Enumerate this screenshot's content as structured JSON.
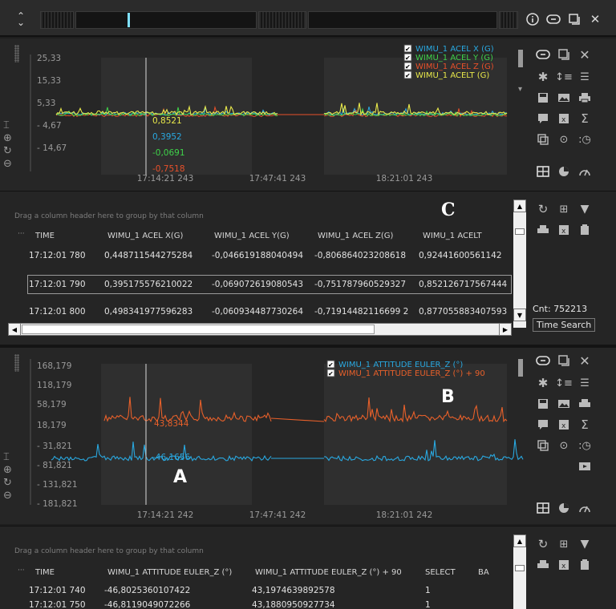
{
  "top_bar": {
    "buttons": [
      "info-icon",
      "link-icon",
      "popout-icon",
      "close-icon"
    ],
    "close_glyph": "✕"
  },
  "chart1": {
    "y_ticks": [
      "25,33",
      "15,33",
      "5,33",
      "- 4,67",
      "- 14,67"
    ],
    "x_ticks": [
      "17:14:21 243",
      "17:47:41 243",
      "18:21:01 243"
    ],
    "cursor_values": [
      {
        "text": "0,8521",
        "color": "#e8e84a"
      },
      {
        "text": "0,3952",
        "color": "#29a8e0"
      },
      {
        "text": "-0,0691",
        "color": "#3fd24a"
      },
      {
        "text": "-0,7518",
        "color": "#e8502a"
      }
    ],
    "legend": [
      {
        "label": "WIMU_1  ACEL X (G)",
        "color": "#29a8e0"
      },
      {
        "label": "WIMU_1  ACEL Y (G)",
        "color": "#3fd24a"
      },
      {
        "label": "WIMU_1  ACEL Z (G)",
        "color": "#e8502a"
      },
      {
        "label": "WIMU_1  ACELT  (G)",
        "color": "#e8e84a"
      }
    ]
  },
  "grid1": {
    "group_hint": "Drag a column header here to group by that column",
    "marker": "C",
    "ellipsis": "···",
    "columns": [
      "TIME",
      "WIMU_1  ACEL X(G)",
      "WIMU_1  ACEL Y(G)",
      "WIMU_1  ACEL Z(G)",
      "WIMU_1  ACELT"
    ],
    "rows": [
      [
        "17:12:01 780",
        "0,448711544275284",
        "-0,046619188040494",
        "-0,806864023208618",
        "0,92441600561142"
      ],
      [
        "17:12:01 790",
        "0,395175576210022",
        "-0,069072619080543",
        "-0,751787960529327",
        "0,852126717567444"
      ],
      [
        "17:12:01 800",
        "0,498341977596283",
        "-0,060934487730264",
        "-0,71914482116699 2",
        "0,877055883407593"
      ]
    ],
    "count_label": "Cnt: 752213",
    "time_search": "Time Search"
  },
  "chart2": {
    "y_ticks": [
      "168,179",
      "118,179",
      "58,179",
      "18,179",
      "- 31,821",
      "- 81,821",
      "- 131,821",
      "- 181,821"
    ],
    "x_ticks": [
      "17:14:21 242",
      "17:47:41 242",
      "18:21:01 242"
    ],
    "cursor_values": [
      {
        "text": "43,8344",
        "color": "#e8602a"
      },
      {
        "text": "-46,1656",
        "color": "#29a8e0"
      }
    ],
    "legend": [
      {
        "label": "WIMU_1  ATTITUDE EULER_Z (°)",
        "color": "#29a8e0"
      },
      {
        "label": "WIMU_1  ATTITUDE EULER_Z (°) + 90",
        "color": "#e8602a"
      }
    ],
    "marker_a": "A",
    "marker_b": "B"
  },
  "grid2": {
    "group_hint": "Drag a column header here to group by that column",
    "ellipsis": "···",
    "columns": [
      "TIME",
      "WIMU_1  ATTITUDE EULER_Z (°)",
      "WIMU_1  ATTITUDE EULER_Z (°) + 90",
      "SELECT",
      "BA"
    ],
    "rows": [
      [
        "17:12:01 740",
        "-46,8025360107422",
        "43,1974639892578",
        "1"
      ],
      [
        "17:12:01 750",
        "-46,8119049072266",
        "43,1880950927734",
        "1"
      ]
    ]
  },
  "colors": {
    "series_blue": "#29a8e0",
    "series_green": "#3fd24a",
    "series_red": "#e8502a",
    "series_yellow": "#e8e84a",
    "series_orange": "#e8602a",
    "background": "#262626"
  }
}
